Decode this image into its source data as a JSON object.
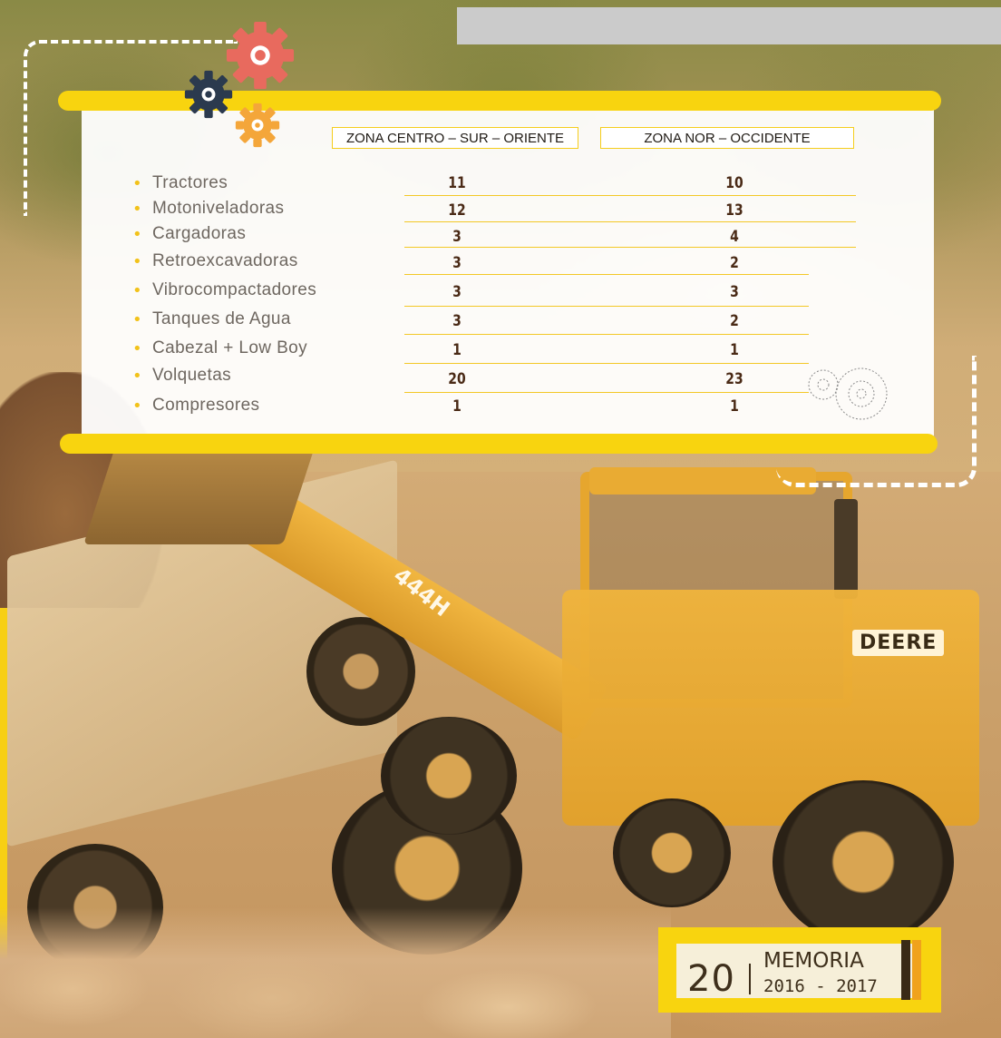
{
  "table": {
    "headers": [
      "ZONA CENTRO – SUR – ORIENTE",
      "ZONA NOR – OCCIDENTE"
    ],
    "rows": [
      {
        "label": "Tractores",
        "centro": "11",
        "nor": "10"
      },
      {
        "label": "Motoniveladoras",
        "centro": "12",
        "nor": "13"
      },
      {
        "label": "Cargadoras",
        "centro": "3",
        "nor": "4"
      },
      {
        "label": "Retroexcavadoras",
        "centro": "3",
        "nor": "2"
      },
      {
        "label": "Vibrocompactadores",
        "centro": "3",
        "nor": "3"
      },
      {
        "label": "Tanques de Agua",
        "centro": "3",
        "nor": "2"
      },
      {
        "label": "Cabezal + Low Boy",
        "centro": "1",
        "nor": "1"
      },
      {
        "label": "Volquetas",
        "centro": "20",
        "nor": "23"
      },
      {
        "label": "Compresores",
        "centro": "1",
        "nor": "1"
      }
    ]
  },
  "footer": {
    "page_number": "20",
    "title": "MEMORIA",
    "years": "2016 - 2017"
  },
  "photo": {
    "loader_brand": "DEERE",
    "loader_model": "444H"
  },
  "colors": {
    "accent_yellow": "#f8d40f",
    "gear_red": "#e86a5e",
    "gear_navy": "#2b3a4e",
    "gear_orange": "#f4a63a",
    "value_brown": "#4a2a16"
  }
}
